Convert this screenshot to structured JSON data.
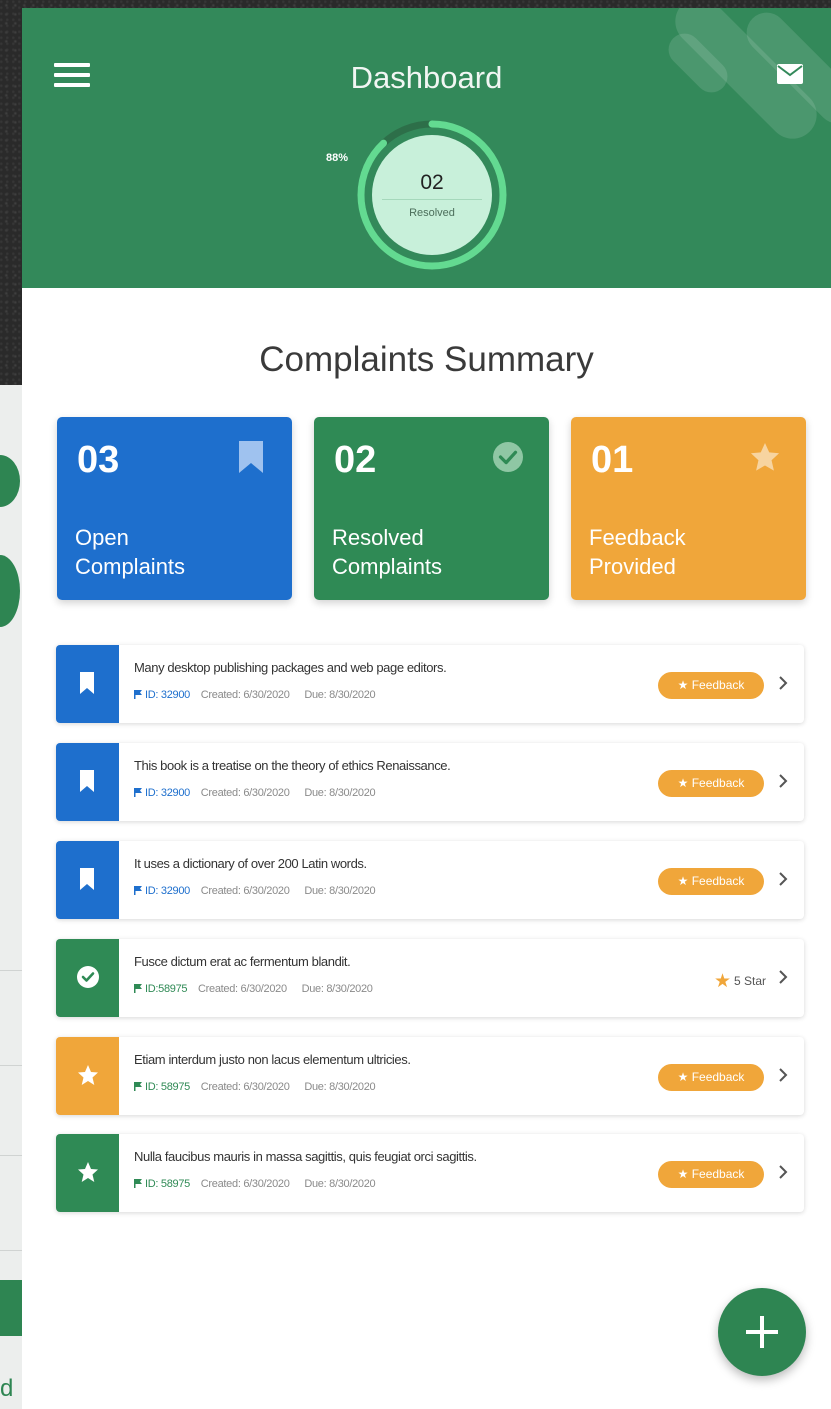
{
  "header": {
    "title": "Dashboard",
    "ring": {
      "percent_label": "88%",
      "value": "02",
      "label": "Resolved",
      "progress": 0.88
    }
  },
  "summary": {
    "title": "Complaints Summary",
    "cards": [
      {
        "count": "03",
        "label_line1": "Open",
        "label_line2": "Complaints",
        "color": "#1e6fcd",
        "icon": "bookmark-icon"
      },
      {
        "count": "02",
        "label_line1": "Resolved",
        "label_line2": "Complaints",
        "color": "#2f8a55",
        "icon": "check-circle-icon"
      },
      {
        "count": "01",
        "label_line1": "Feedback",
        "label_line2": "Provided",
        "color": "#f0a63a",
        "icon": "star-icon"
      }
    ]
  },
  "complaints": [
    {
      "text": "Many desktop publishing packages and web page editors.",
      "id": "ID: 32900",
      "created": "Created: 6/30/2020",
      "due": "Due: 8/30/2020",
      "status": "open",
      "action": "Feedback"
    },
    {
      "text": "This book is a treatise on the theory of ethics Renaissance.",
      "id": "ID: 32900",
      "created": "Created: 6/30/2020",
      "due": "Due: 8/30/2020",
      "status": "open",
      "action": "Feedback"
    },
    {
      "text": "It uses a dictionary of over 200 Latin words.",
      "id": "ID: 32900",
      "created": "Created: 6/30/2020",
      "due": "Due: 8/30/2020",
      "status": "open",
      "action": "Feedback"
    },
    {
      "text": "Fusce dictum erat ac fermentum blandit.",
      "id": "ID:58975",
      "created": "Created: 6/30/2020",
      "due": "Due: 8/30/2020",
      "status": "resolved",
      "rating": "5 Star"
    },
    {
      "text": "Etiam interdum justo non lacus elementum ultricies.",
      "id": "ID: 58975",
      "created": "Created: 6/30/2020",
      "due": "Due: 8/30/2020",
      "status": "feedback",
      "action": "Feedback"
    },
    {
      "text": "Nulla faucibus mauris in massa sagittis, quis feugiat orci sagittis.",
      "id": "ID: 58975",
      "created": "Created: 6/30/2020",
      "due": "Due: 8/30/2020",
      "status": "starred",
      "action": "Feedback"
    }
  ],
  "colors": {
    "blue": "#1e6fcd",
    "green": "#2f8a55",
    "orange": "#f0a63a",
    "header_green": "#33895a"
  },
  "fab": {
    "icon": "plus-icon"
  },
  "background_partial": {
    "letter": "d"
  }
}
